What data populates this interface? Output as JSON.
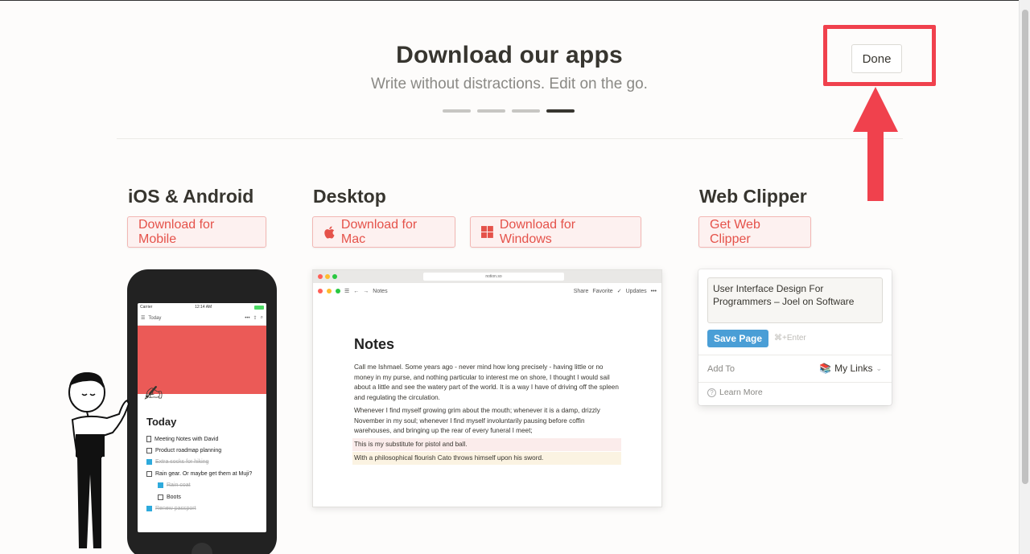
{
  "header": {
    "title": "Download our apps",
    "subtitle": "Write without distractions. Edit on the go."
  },
  "pager": {
    "count": 4,
    "active_index": 3
  },
  "done_label": "Done",
  "sections": {
    "mobile": {
      "title": "iOS & Android",
      "button": "Download for Mobile"
    },
    "desktop": {
      "title": "Desktop",
      "mac_button": "Download for Mac",
      "windows_button": "Download for Windows"
    },
    "clipper": {
      "title": "Web Clipper",
      "button": "Get Web Clipper"
    }
  },
  "phone": {
    "carrier": "Carrier",
    "time": "12:14 AM",
    "page_title": "Today",
    "breadcrumb": "Today",
    "items": [
      {
        "text": "Meeting Notes with David",
        "type": "page",
        "checked": false
      },
      {
        "text": "Product roadmap planning",
        "type": "todo",
        "checked": false
      },
      {
        "text": "Extra socks for hiking",
        "type": "todo",
        "checked": true
      },
      {
        "text": "Rain gear. Or maybe get them at Muji?",
        "type": "todo",
        "checked": false
      },
      {
        "text": "Rain coat",
        "type": "todo",
        "checked": true,
        "indent": true
      },
      {
        "text": "Boots",
        "type": "todo",
        "checked": false,
        "indent": true
      },
      {
        "text": "Renew passport",
        "type": "todo",
        "checked": true
      }
    ]
  },
  "desktop_mock": {
    "url": "notion.so",
    "breadcrumb": "Notes",
    "share": "Share",
    "favorite": "Favorite",
    "updates": "Updates",
    "page_title": "Notes",
    "paragraph1": "Call me Ishmael. Some years ago - never mind how long precisely - having little or no money in my purse, and nothing particular to interest me on shore, I thought I would sail about a little and see the watery part of the world. It is a way I have of driving off the spleen and regulating the circulation.",
    "paragraph2": "Whenever I find myself growing grim about the mouth; whenever it is a damp, drizzly November in my soul; whenever I find myself involuntarily pausing before coffin warehouses, and bringing up the rear of every funeral I meet;",
    "highlight1": "This is my substitute for pistol and ball.",
    "highlight2": "With a philosophical flourish Cato throws himself upon his sword."
  },
  "clipper_mock": {
    "page_title": "User Interface Design For Programmers – Joel on Software",
    "save_label": "Save Page",
    "shortcut": "⌘+Enter",
    "add_to": "Add To",
    "destination": "My Links",
    "learn_more": "Learn More"
  },
  "colors": {
    "accent_red": "#e5524a",
    "highlight_red": "#f0414d",
    "save_blue": "#4a9ed6"
  }
}
